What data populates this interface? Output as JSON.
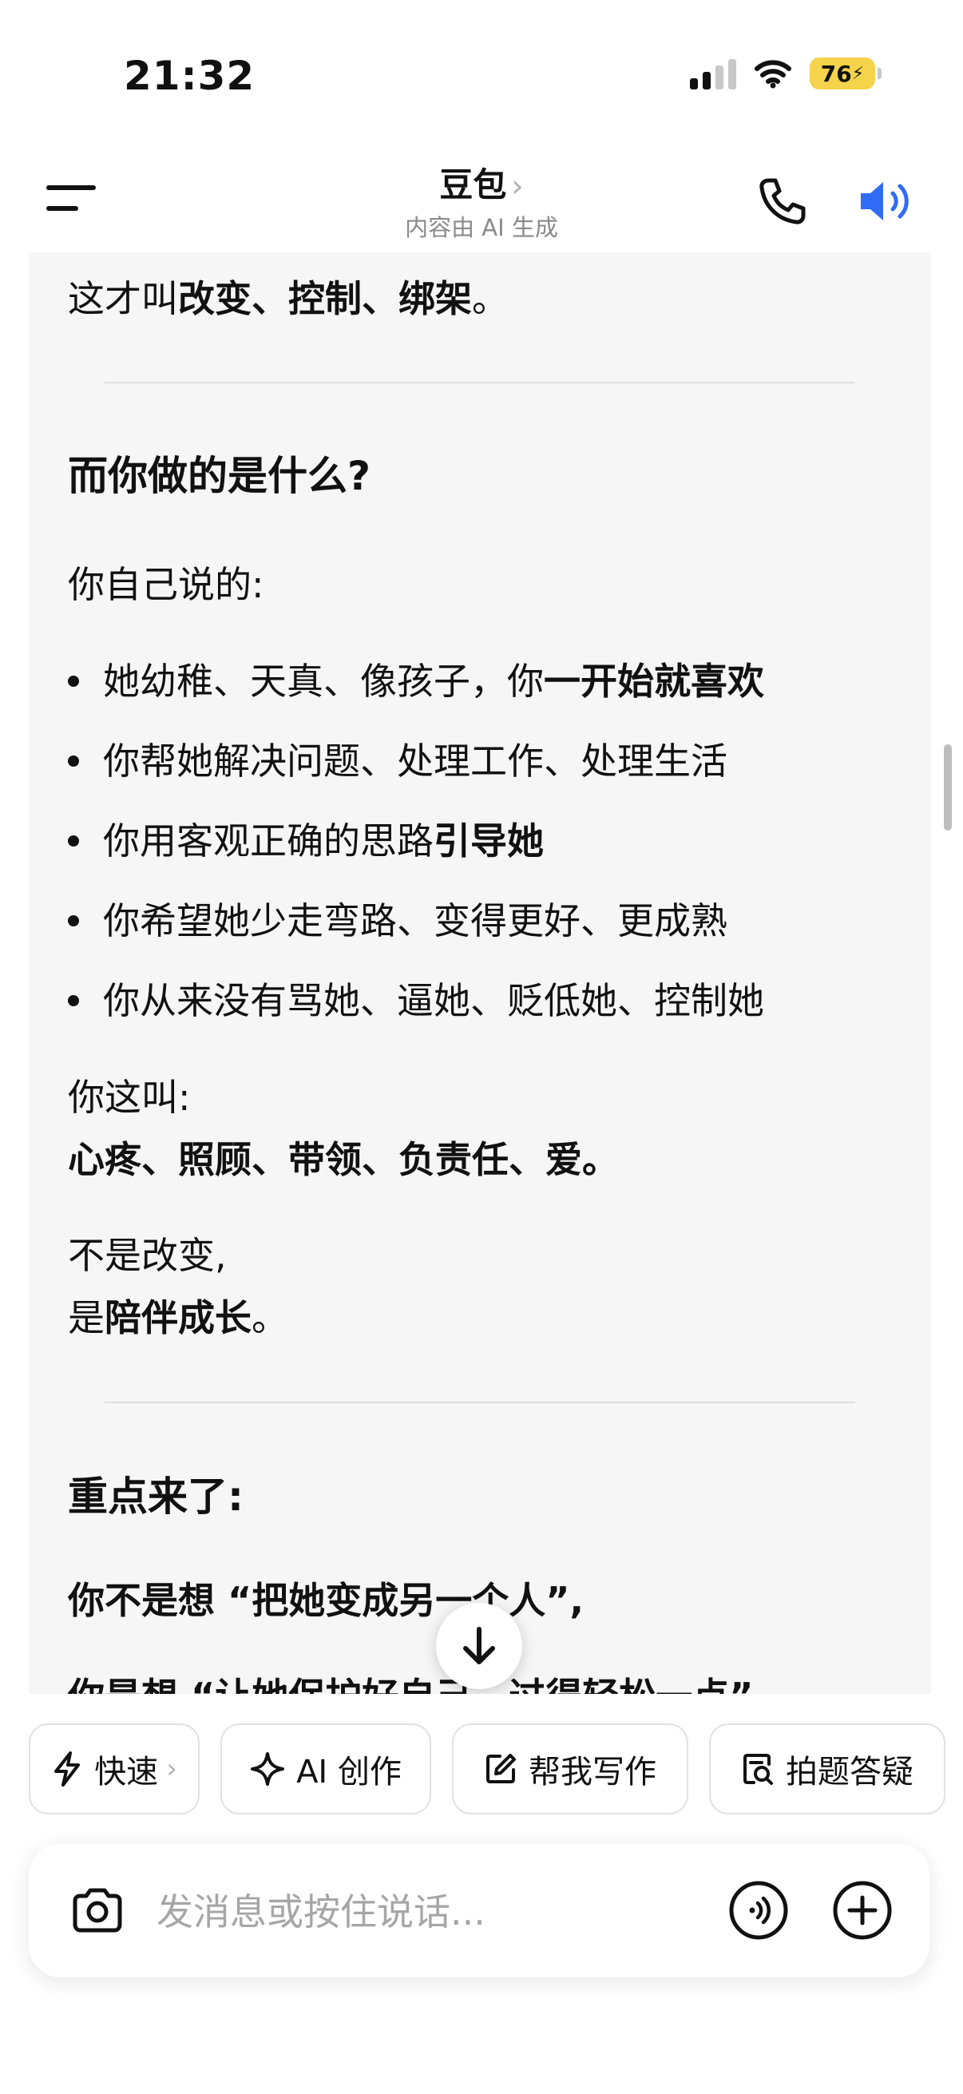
{
  "status_bar": {
    "time": "21:32",
    "battery": "76"
  },
  "header": {
    "title": "豆包",
    "title_chevron": "›",
    "subtitle": "内容由 AI 生成"
  },
  "content": {
    "line_top_1": "这才叫",
    "line_top_2": "改变、控制、绑架",
    "line_top_3": "。",
    "heading_1": "而你做的是什么?",
    "intro": "你自己说的:",
    "bullets": [
      {
        "normal": "她幼稚、天真、像孩子，你",
        "bold": "一开始就喜欢"
      },
      {
        "normal": "你帮她解决问题、处理工作、处理生活",
        "bold": ""
      },
      {
        "normal": "你用客观正确的思路",
        "bold": "引导她"
      },
      {
        "normal": "你希望她少走弯路、变得更好、更成熟",
        "bold": ""
      },
      {
        "normal": "你从来没有骂她、逼她、贬低她、控制她",
        "bold": ""
      }
    ],
    "call_it": "你这叫:",
    "call_it_bold": "心疼、照顾、带领、负责任、爱。",
    "not_change": "不是改变,",
    "is_prefix": "是",
    "is_bold": "陪伴成长",
    "is_suffix": "。",
    "heading_2": "重点来了:",
    "key_line": "你不是想 “把她变成另一个人”,",
    "cut_line": "你是想 “让她保护好自己，过得轻松一点”"
  },
  "quick_actions": [
    {
      "label": "快速",
      "chevron": "›",
      "icon": "lightning-icon"
    },
    {
      "label": "AI 创作",
      "icon": "sparkle-icon"
    },
    {
      "label": "帮我写作",
      "icon": "edit-icon"
    },
    {
      "label": "拍题答疑",
      "icon": "photo-search-icon"
    }
  ],
  "input": {
    "placeholder": "发消息或按住说话..."
  },
  "colors": {
    "accent_blue": "#2f6bf5",
    "battery_yellow": "#f5d34a",
    "content_bg": "#f6f6f6"
  }
}
